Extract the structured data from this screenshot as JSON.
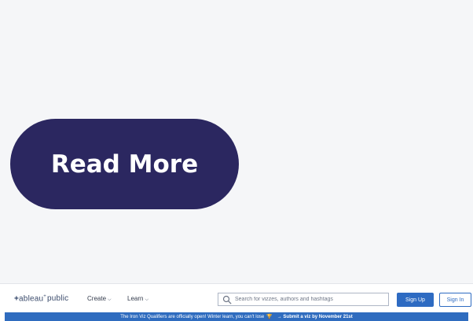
{
  "read_more_button": {
    "label": "Read More"
  },
  "tableau_public": {
    "logo": {
      "plus": "+",
      "text": "ableau",
      "sup": "+",
      "suffix": "public"
    },
    "menu": {
      "create": "Create",
      "learn": "Learn"
    },
    "search": {
      "placeholder": "Search for vizzes, authors and hashtags",
      "value": ""
    },
    "sign_up": "Sign Up",
    "sign_in": "Sign In",
    "banner": {
      "text": "The Iron Viz Qualifiers are officially open! Winter learn, you can't lose",
      "link": "→ Submit a viz by November 21st"
    }
  },
  "colors": {
    "background": "#f5f6f8",
    "button_navy": "#2b2760",
    "tableau_blue": "#2e6bc2",
    "trophy": "#f3c945"
  },
  "icons": {
    "search": "magnifier-icon",
    "chevron": "chevron-down-icon",
    "trophy": "trophy-icon"
  }
}
